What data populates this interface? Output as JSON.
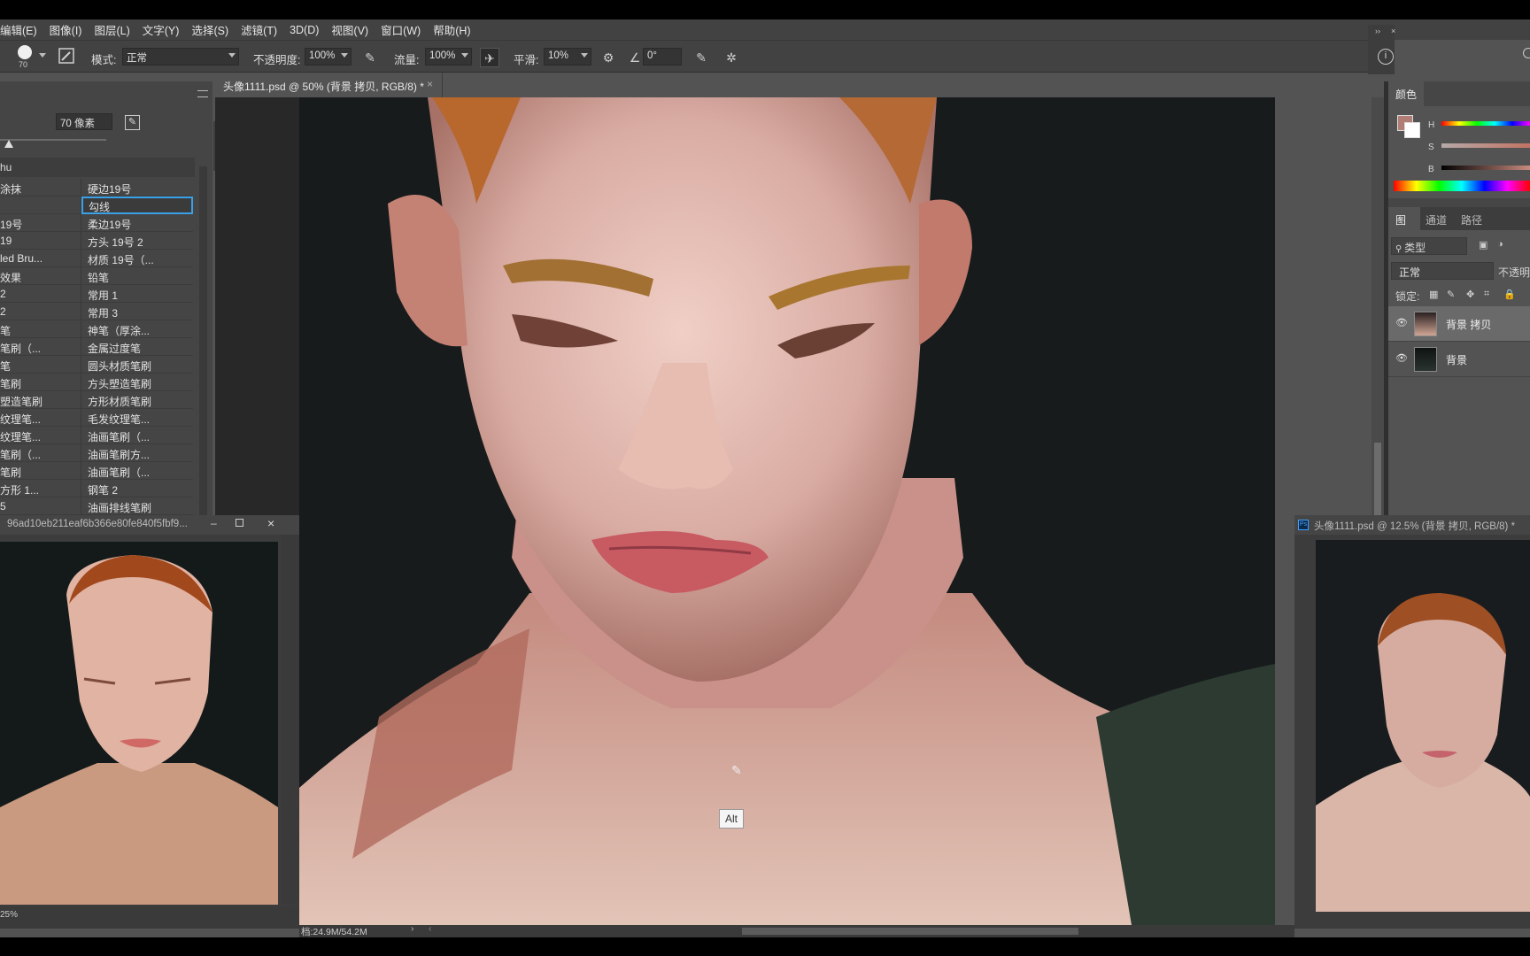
{
  "menu": [
    "编辑(E)",
    "图像(I)",
    "图层(L)",
    "文字(Y)",
    "选择(S)",
    "滤镜(T)",
    "3D(D)",
    "视图(V)",
    "窗口(W)",
    "帮助(H)"
  ],
  "options": {
    "brush_size": "70",
    "mode_label": "模式:",
    "mode_value": "正常",
    "opacity_label": "不透明度:",
    "opacity_value": "100%",
    "flow_label": "流量:",
    "flow_value": "100%",
    "smooth_label": "平滑:",
    "smooth_value": "10%",
    "angle_value": "0°"
  },
  "document": {
    "tab_title": "头像1111.psd @ 50% (背景 拷贝, RGB/8) *",
    "status": "档:24.9M/54.2M",
    "tooltip": "Alt"
  },
  "brush_panel": {
    "size_value": "70 像素",
    "group_name": "hu",
    "rows": [
      [
        "涂抹",
        "硬边19号"
      ],
      [
        "",
        "勾线"
      ],
      [
        "19号",
        "柔边19号"
      ],
      [
        "19",
        "方头 19号 2"
      ],
      [
        "led Bru...",
        "材质 19号（..."
      ],
      [
        "效果",
        "铅笔"
      ],
      [
        "2",
        "常用 1"
      ],
      [
        "2",
        "常用 3"
      ],
      [
        "笔",
        "神笔（厚涂..."
      ],
      [
        "笔刷（...",
        "金属过度笔"
      ],
      [
        "笔",
        "圆头材质笔刷"
      ],
      [
        "笔刷",
        "方头塑造笔刷"
      ],
      [
        "塑造笔刷",
        "方形材质笔刷"
      ],
      [
        "纹理笔...",
        "毛发纹理笔..."
      ],
      [
        "纹理笔...",
        "油画笔刷（..."
      ],
      [
        "笔刷（...",
        "油画笔刷方..."
      ],
      [
        "笔刷",
        "油画笔刷（..."
      ],
      [
        "方形 1...",
        "钢笔 2"
      ],
      [
        "5",
        "油画排线笔刷"
      ]
    ]
  },
  "ref_window": {
    "title": "96ad10eb211eaf6b366e80fe840f5fbf9...",
    "zoom": "25%"
  },
  "nav_window": {
    "title": "头像1111.psd @ 12.5% (背景 拷贝, RGB/8) *"
  },
  "color_panel": {
    "tab": "颜色",
    "h_label": "H",
    "s_label": "S",
    "b_label": "B",
    "fg_color": "#b17e76"
  },
  "layers_panel": {
    "tabs": [
      "图层",
      "通道",
      "路径"
    ],
    "filter_label": "类型",
    "blend_mode": "正常",
    "opacity_label": "不透明",
    "lock_label": "锁定:",
    "layers": [
      {
        "name": "背景 拷贝",
        "selected": true
      },
      {
        "name": "背景",
        "selected": false
      }
    ]
  }
}
